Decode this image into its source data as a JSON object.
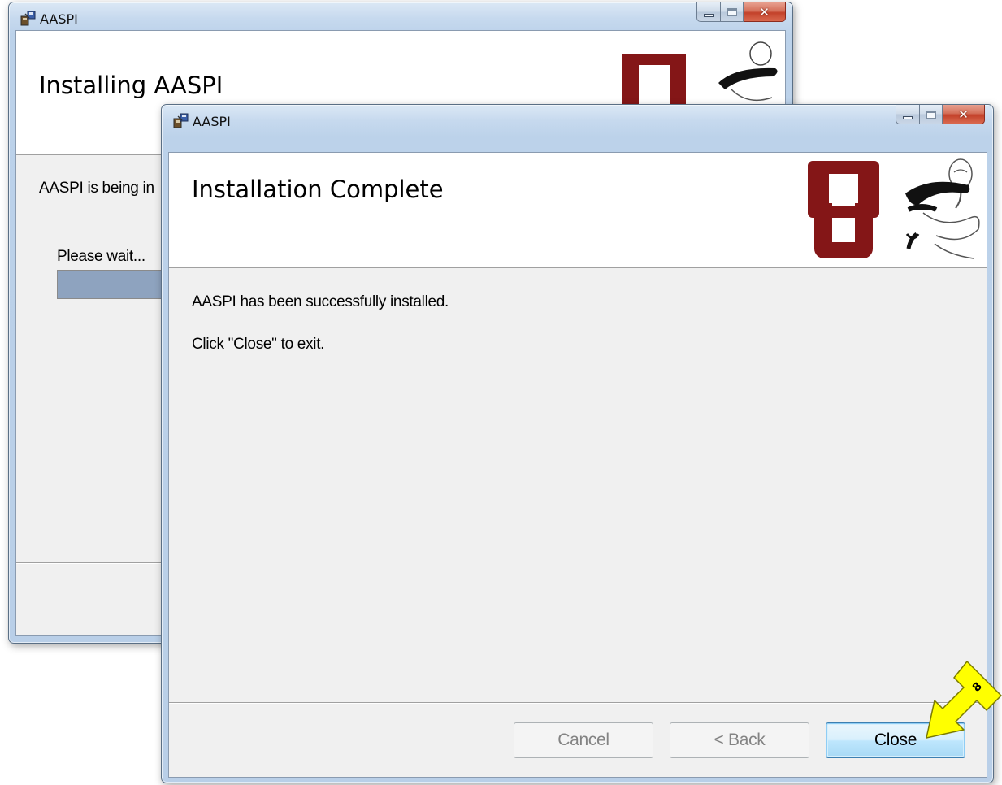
{
  "back_window": {
    "title": "AASPI",
    "header": "Installing AASPI",
    "body_text": "AASPI is being in",
    "wait_label": "Please wait...",
    "progress": 0.32
  },
  "front_window": {
    "title": "AASPI",
    "header": "Installation Complete",
    "message_line1": "AASPI has been successfully installed.",
    "message_line2": "Click \"Close\" to exit.",
    "buttons": {
      "cancel": "Cancel",
      "back": "< Back",
      "close": "Close"
    },
    "default_button": "close",
    "disabled_buttons": [
      "cancel",
      "back"
    ]
  },
  "callout": {
    "step_number": "8",
    "color": "#ffff00"
  },
  "icons": {
    "app": "installer-icon",
    "logo": "ou-logo",
    "mascot": "mascot-logo",
    "minimize": "minimize-icon",
    "maximize": "maximize-icon",
    "close": "close-icon"
  },
  "colors": {
    "ou_crimson": "#841617",
    "close_button_red": "#c3412a",
    "default_button_blue": "#3c7fb1"
  }
}
